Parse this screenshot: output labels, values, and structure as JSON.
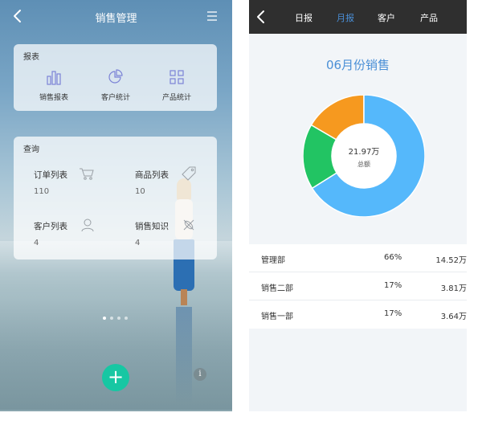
{
  "left": {
    "header": {
      "title": "销售管理"
    },
    "report": {
      "title": "报表",
      "items": [
        {
          "label": "销售报表"
        },
        {
          "label": "客户统计"
        },
        {
          "label": "产品统计"
        }
      ]
    },
    "query": {
      "title": "查询",
      "items": [
        {
          "label": "订单列表",
          "count": "110"
        },
        {
          "label": "商品列表",
          "count": "10"
        },
        {
          "label": "客户列表",
          "count": "4"
        },
        {
          "label": "销售知识",
          "count": "4"
        }
      ]
    },
    "pager": {
      "pages": 4,
      "active": 1
    },
    "fab_label": "+",
    "info_label": "i",
    "colors": {
      "icon_accent": "#7c83d6",
      "fab": "#17c7a3"
    }
  },
  "right": {
    "tabs": [
      {
        "label": "日报",
        "active": false
      },
      {
        "label": "月报",
        "active": true
      },
      {
        "label": "客户",
        "active": false
      },
      {
        "label": "产品",
        "active": false
      }
    ],
    "chart_data": {
      "type": "pie",
      "title": "06月份销售",
      "center_value": "21.97万",
      "center_label": "总额",
      "categories": [
        "管理部",
        "销售二部",
        "销售一部"
      ],
      "values": [
        14.52,
        3.81,
        3.64
      ],
      "percents": [
        66,
        17,
        17
      ],
      "colors": [
        "#55b8fb",
        "#22c463",
        "#f6991f"
      ],
      "unit": "万"
    },
    "table": [
      {
        "dept": "管理部",
        "pct": "66%",
        "amount": "14.52万"
      },
      {
        "dept": "销售二部",
        "pct": "17%",
        "amount": "3.81万"
      },
      {
        "dept": "销售一部",
        "pct": "17%",
        "amount": "3.64万"
      }
    ],
    "colors": {
      "nav_bg": "#2f2f2f",
      "tab_active": "#4a90d9",
      "title": "#4a8fd6"
    }
  }
}
